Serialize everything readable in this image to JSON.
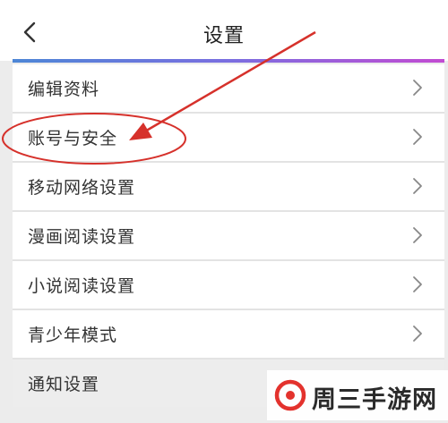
{
  "header": {
    "title": "设置",
    "back_icon": "chevron-left-icon"
  },
  "settings": {
    "items": [
      {
        "label": "编辑资料"
      },
      {
        "label": "账号与安全"
      },
      {
        "label": "移动网络设置"
      },
      {
        "label": "漫画阅读设置"
      },
      {
        "label": "小说阅读设置"
      },
      {
        "label": "青少年模式"
      },
      {
        "label": "通知设置"
      }
    ]
  },
  "colors": {
    "annotation": "#d6312b",
    "gradient_start": "#4d86d6",
    "gradient_end": "#c24bd2",
    "watermark_logo": "#e3322d"
  },
  "watermark": {
    "text": "周三手游网"
  }
}
